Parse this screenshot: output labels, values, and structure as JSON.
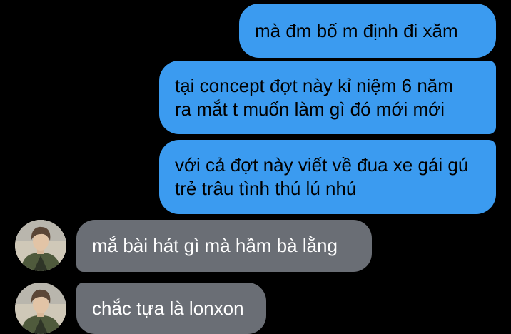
{
  "conversation": {
    "messages": [
      {
        "direction": "sent",
        "text": "mà đm bố m định đi xăm"
      },
      {
        "direction": "sent",
        "text": "tại concept đợt này kỉ niệm 6 năm\nra mắt t muốn làm gì đó mới mới"
      },
      {
        "direction": "sent",
        "text": "với cả đợt này viết về đua xe gái gú\ntrẻ trâu tình thú lú nhú"
      },
      {
        "direction": "received",
        "text": "mắ bài hát gì mà hầm bà lằng"
      },
      {
        "direction": "received",
        "text": "chắc tựa là lonxon"
      }
    ]
  },
  "colors": {
    "background": "#000000",
    "sent_bubble": "#3b9bf0",
    "received_bubble": "#6a6e75"
  },
  "icons": {
    "contact_avatar": "contact-avatar-photo"
  }
}
